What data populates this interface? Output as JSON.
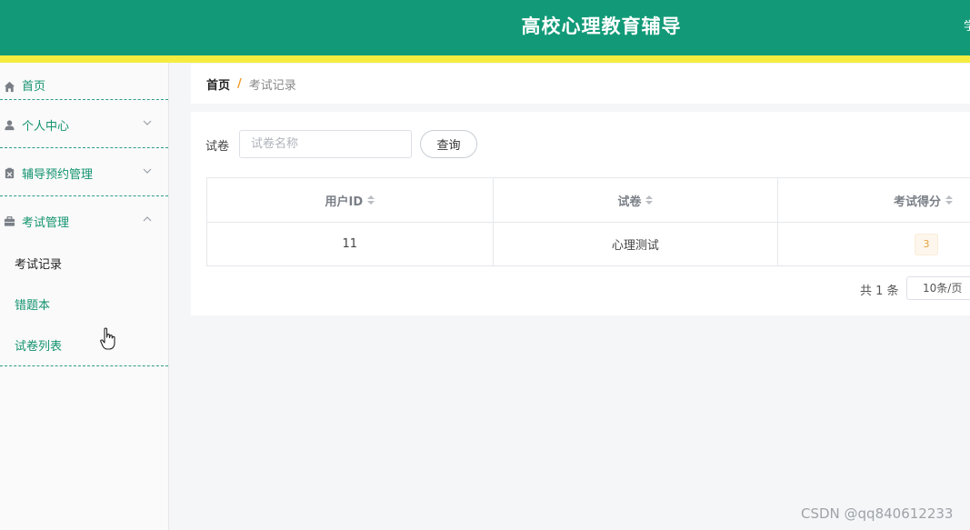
{
  "header": {
    "title": "高校心理教育辅导",
    "user_partial": "学"
  },
  "sidebar": {
    "items": [
      {
        "label": "首页",
        "icon": "home-icon"
      },
      {
        "label": "个人中心",
        "icon": "user-icon",
        "expanded": false
      },
      {
        "label": "辅导预约管理",
        "icon": "clipboard-icon",
        "expanded": false
      },
      {
        "label": "考试管理",
        "icon": "briefcase-icon",
        "expanded": true
      }
    ],
    "sub_items": [
      {
        "label": "考试记录",
        "active": true
      },
      {
        "label": "错题本",
        "active": false
      },
      {
        "label": "试卷列表",
        "active": false
      }
    ]
  },
  "breadcrumb": {
    "home": "首页",
    "separator": "/",
    "current": "考试记录"
  },
  "search": {
    "label": "试卷",
    "placeholder": "试卷名称",
    "button": "查询"
  },
  "table": {
    "columns": [
      "用户ID",
      "试卷",
      "考试得分"
    ],
    "rows": [
      {
        "user_id": "11",
        "paper": "心理测试",
        "score": "3"
      }
    ]
  },
  "pagination": {
    "total": "共 1 条",
    "page_size": "10条/页"
  },
  "watermark": "CSDN @qq840612233",
  "colors": {
    "header": "#129a78",
    "stripe": "#f5ec3f",
    "menu_text": "#13936f",
    "badge_text": "#e6a23c"
  }
}
